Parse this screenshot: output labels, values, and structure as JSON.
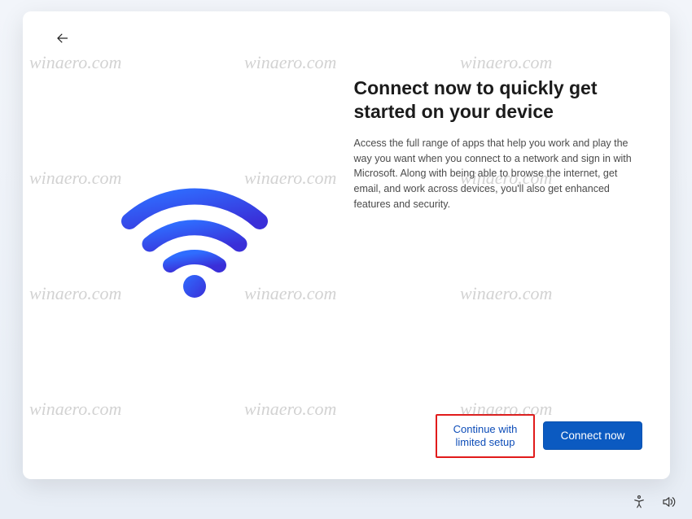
{
  "heading": "Connect now to quickly get started on your device",
  "body": "Access the full range of apps that help you work and play the way you want when you connect to a network and sign in with Microsoft. Along with being able to browse the internet, get email, and work across devices, you'll also get enhanced features and security.",
  "actions": {
    "secondary": "Continue with limited setup",
    "primary": "Connect now"
  },
  "watermark": "winaero.com"
}
